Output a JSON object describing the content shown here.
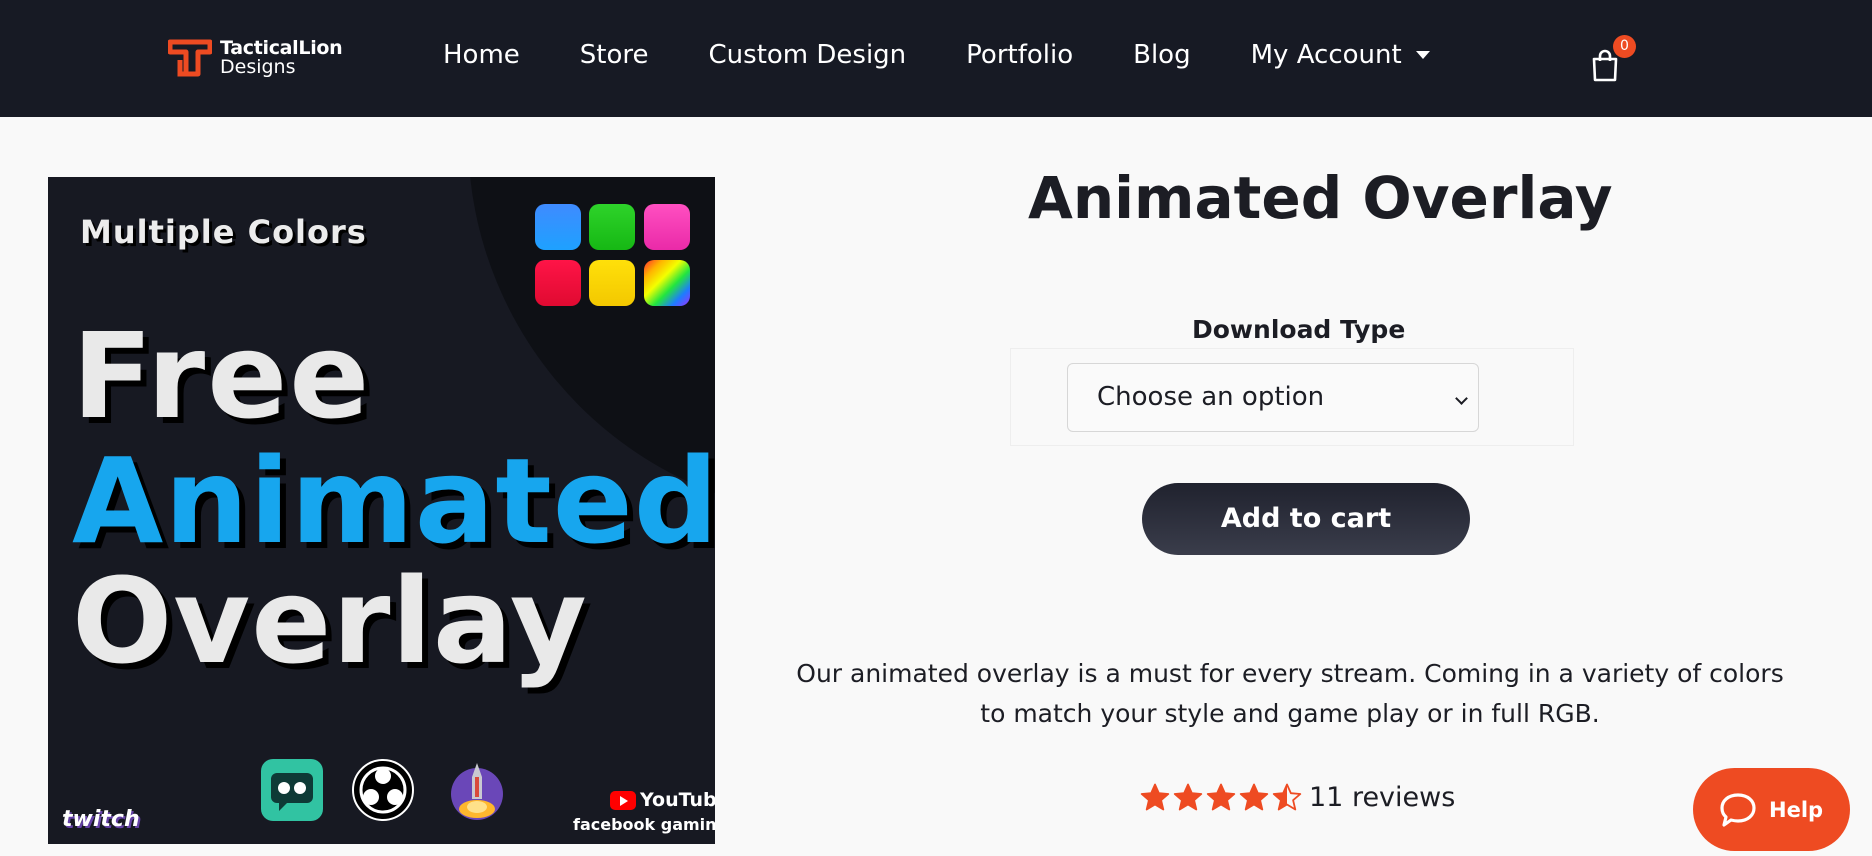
{
  "header": {
    "logo": {
      "line1": "TacticalLion",
      "line2": "Designs"
    },
    "nav": [
      "Home",
      "Store",
      "Custom Design",
      "Portfolio",
      "Blog"
    ],
    "account_label": "My Account",
    "cart_count": "0"
  },
  "product_image": {
    "headline_colors": "Multiple Colors",
    "line_free": "Free",
    "line_animated": "Animated",
    "line_overlay": "Overlay",
    "platform_twitch": "twitch",
    "platform_youtube": "YouTube",
    "platform_facebook": "facebook gaming",
    "swatch_colors": [
      "#2e8bf0",
      "#22d41d",
      "#f23fb6",
      "#f0103a",
      "#ffd60a",
      "rainbow"
    ]
  },
  "product": {
    "title": "Animated Overlay",
    "download_type_label": "Download Type",
    "select_value": "Choose an option",
    "add_to_cart_label": "Add to cart",
    "description": "Our animated overlay is a must for every stream. Coming in a variety of colors to match your style and game play or in full RGB.",
    "rating": 4.5,
    "reviews_label": "11 reviews"
  },
  "help": {
    "label": "Help"
  },
  "colors": {
    "accent": "#ee4b22",
    "header_bg": "#171a24",
    "button_dark": "#2a2c38"
  }
}
